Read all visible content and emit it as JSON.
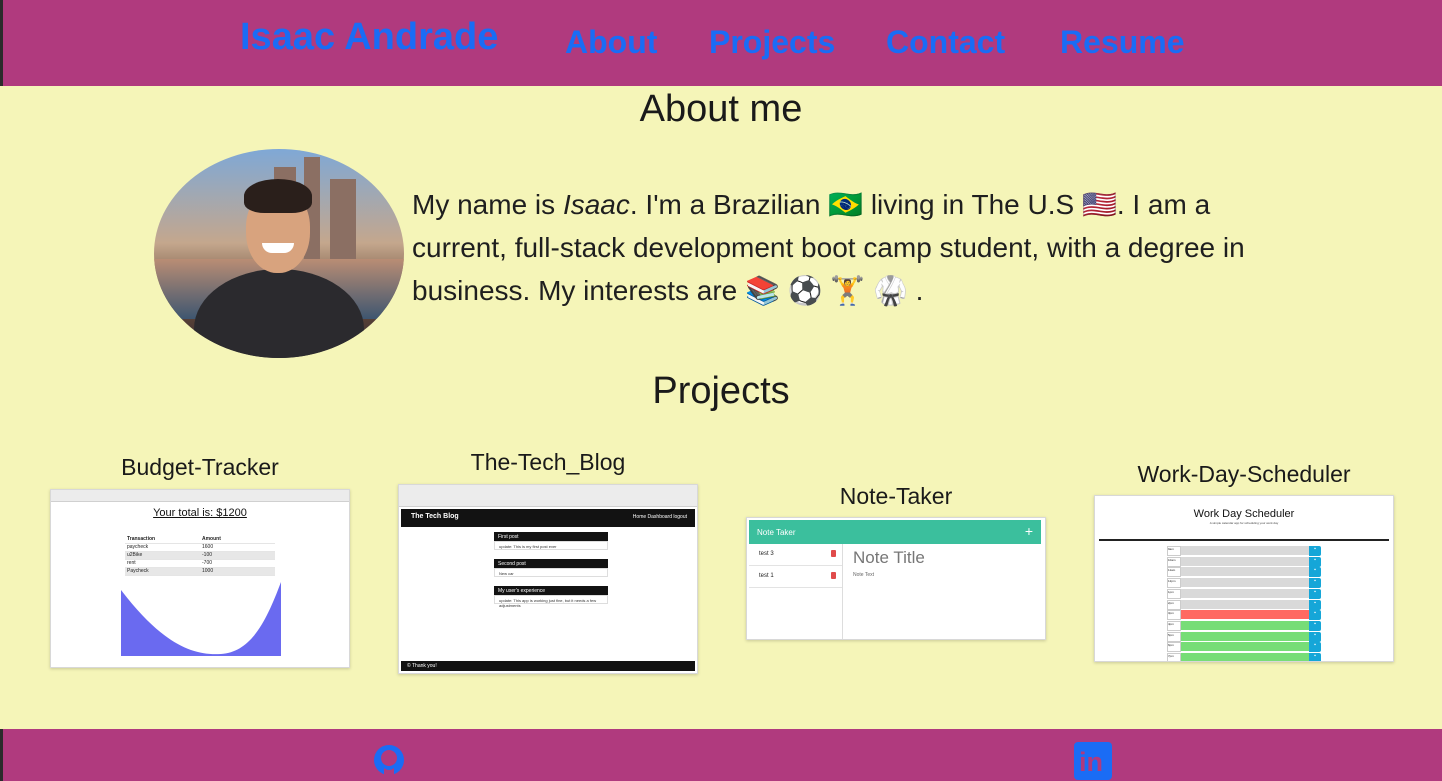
{
  "header": {
    "brand": "Isaac Andrade",
    "nav": [
      "About",
      "Projects",
      "Contact",
      "Resume"
    ]
  },
  "about": {
    "title": "About me",
    "bio_part1": "My name is ",
    "bio_name": "Isaac",
    "bio_part2": ". I'm a Brazilian 🇧🇷 living in The U.S 🇺🇸. I am a current, full-stack development boot camp student, with a degree in business. My interests are 📚 ⚽️ 🏋️ 🥋 ."
  },
  "projects": {
    "title": "Projects",
    "items": [
      {
        "name": "Budget-Tracker",
        "screenshot": {
          "total": "Your total is: $1200",
          "columns": [
            "Transaction",
            "Amount"
          ],
          "rows": [
            [
              "paycheck",
              "1600"
            ],
            [
              "u2Bike",
              "-100"
            ],
            [
              "rent",
              "-700"
            ],
            [
              "Paycheck",
              "1000"
            ]
          ]
        }
      },
      {
        "name": "The-Tech_Blog",
        "screenshot": {
          "brand": "The Tech Blog",
          "links": "Home   Dashboard   logout",
          "posts": [
            {
              "title": "First post",
              "body": "update: This is my first post ever"
            },
            {
              "title": "Second post",
              "body": "New car"
            },
            {
              "title": "My user's experience",
              "body": "update: This app is working just fine, but it needs a few adjustments"
            }
          ],
          "footer": "© Thank you!"
        }
      },
      {
        "name": "Note-Taker",
        "screenshot": {
          "header": "Note Taker",
          "plus": "+",
          "notes": [
            "test 3",
            "test 1"
          ],
          "note_title": "Note Title",
          "note_text": "Note Text"
        }
      },
      {
        "name": "Work-Day-Scheduler",
        "screenshot": {
          "title": "Work Day Scheduler",
          "subtitle": "A simple calendar app for scheduling your work day",
          "hours": [
            "9am",
            "10am",
            "11am",
            "12pm",
            "1pm",
            "2pm",
            "3pm",
            "4pm",
            "5pm",
            "6pm",
            "7pm"
          ],
          "row_colors": [
            "#d9d9d9",
            "#d9d9d9",
            "#d9d9d9",
            "#d9d9d9",
            "#d9d9d9",
            "#d9d9d9",
            "#ff6961",
            "#77dd77",
            "#77dd77",
            "#77dd77",
            "#77dd77"
          ]
        }
      }
    ]
  },
  "colors": {
    "header_bg": "#b03a7e",
    "page_bg": "#f5f5b8",
    "link": "#1a6cf5"
  },
  "footer": {
    "icons": [
      "github-icon",
      "linkedin-icon"
    ],
    "linkedin_text": "in"
  }
}
